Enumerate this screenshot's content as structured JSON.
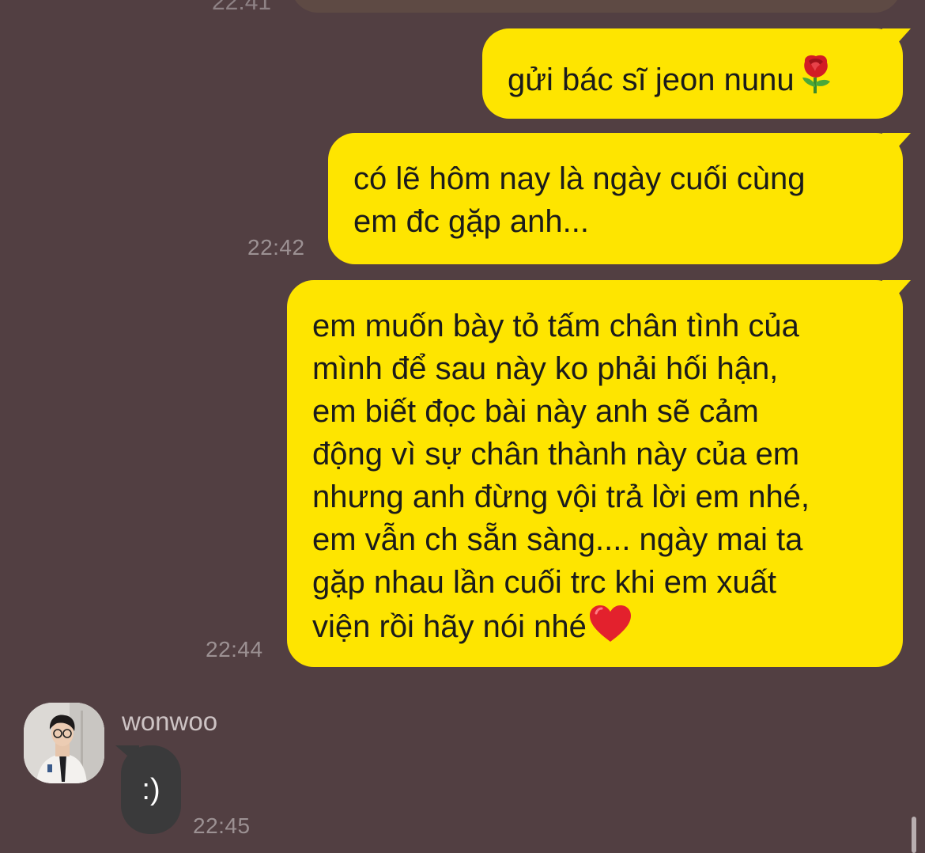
{
  "chat": {
    "previous_time": "22:41",
    "messages": [
      {
        "id": "m1",
        "direction": "outgoing",
        "text": "gửi bác sĩ jeon nunu",
        "emoji": "rose"
      },
      {
        "id": "m2",
        "direction": "outgoing",
        "line1": "có lẽ hôm nay là ngày cuối cùng",
        "line2": "em đc gặp anh...",
        "time": "22:42"
      },
      {
        "id": "m3",
        "direction": "outgoing",
        "lines": [
          "em muốn bày tỏ tấm chân tình của",
          "mình để sau này ko phải hối hận,",
          "em biết đọc bài này anh sẽ cảm",
          "động vì sự chân thành này của em",
          "nhưng anh đừng vội trả lời em nhé,",
          "em vẫn ch sẵn sàng.... ngày mai ta",
          "gặp nhau lần cuối trc khi em xuất",
          "viện rồi hãy nói nhé"
        ],
        "emoji": "red-heart",
        "time": "22:44"
      },
      {
        "id": "m4",
        "direction": "incoming",
        "sender": "wonwoo",
        "text": ":)",
        "time": "22:45"
      }
    ]
  },
  "colors": {
    "background": "#523f42",
    "outgoing_bubble": "#fee500",
    "incoming_bubble": "#3a3a3b",
    "timestamp": "#9c9193"
  }
}
